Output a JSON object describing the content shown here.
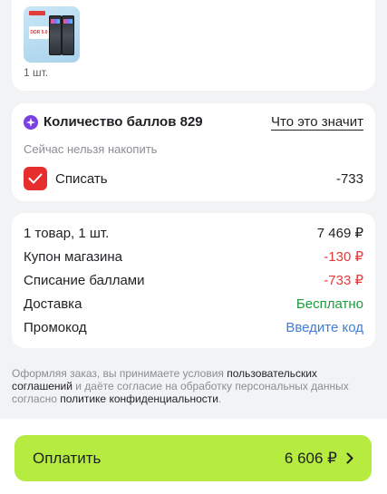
{
  "product": {
    "thumb_label": "DDR 5.0",
    "quantity": "1 шт."
  },
  "bonus": {
    "icon": "sparkle-icon",
    "title": "Количество баллов 829",
    "link": "Что это значит",
    "note": "Сейчас нельзя накопить",
    "checkbox_checked": true,
    "checkbox_label": "Списать",
    "writeoff_value": "-733"
  },
  "summary": {
    "rows": [
      {
        "label": "1 товар, 1 шт.",
        "value": "7 469 ₽",
        "color": "#1f2024"
      },
      {
        "label": "Купон магазина",
        "value": "-130 ₽",
        "color": "#e53a3a"
      },
      {
        "label": "Списание баллами",
        "value": "-733 ₽",
        "color": "#e53a3a"
      },
      {
        "label": "Доставка",
        "value": "Бесплатно",
        "color": "#1a9c3a"
      },
      {
        "label": "Промокод",
        "value": "Введите код",
        "color": "#3f7fd9"
      }
    ]
  },
  "agreement": {
    "part1": "Оформляя заказ, вы принимаете условия ",
    "link1": "пользовательских соглашений",
    "part2": " и даёте согласие на обработку персональных данных согласно ",
    "link2": "политике конфиденциальности",
    "part3": "."
  },
  "pay": {
    "label": "Оплатить",
    "amount": "6 606 ₽",
    "color": "#b5ec3f"
  },
  "colors": {
    "accent_red": "#e62e2e",
    "bonus_purple": "#7b3fe4",
    "pay_green": "#b5ec3f"
  }
}
